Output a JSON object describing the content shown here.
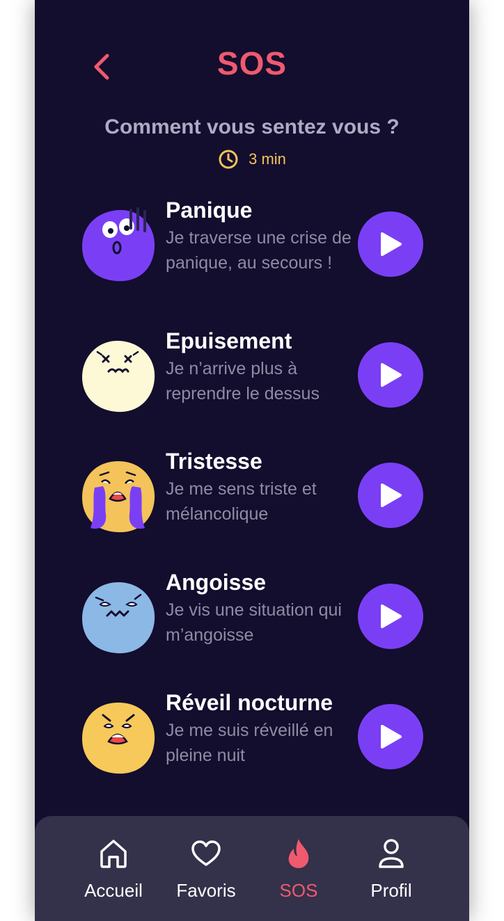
{
  "header": {
    "title": "SOS",
    "back_icon": "chevron-left-icon"
  },
  "prompt": {
    "question": "Comment vous sentez vous ?",
    "duration": "3 min",
    "duration_icon": "clock-icon"
  },
  "moods": [
    {
      "title": "Panique",
      "description": "Je traverse une crise de panique, au secours !",
      "emoji_icon": "panicked-face-icon",
      "emoji_color": "#7a3ff5"
    },
    {
      "title": "Epuisement",
      "description": "Je n’arrive plus à reprendre  le dessus",
      "emoji_icon": "exhausted-face-icon",
      "emoji_color": "#fdf9d6"
    },
    {
      "title": "Tristesse",
      "description": "Je me sens triste et mélancolique",
      "emoji_icon": "crying-face-icon",
      "emoji_color": "#f4c35a"
    },
    {
      "title": "Angoisse",
      "description": "Je vis une situation qui m’angoisse",
      "emoji_icon": "anxious-face-icon",
      "emoji_color": "#8cb8e6"
    },
    {
      "title": "Réveil nocturne",
      "description": "Je me suis réveillé en pleine nuit",
      "emoji_icon": "shocked-face-icon",
      "emoji_color": "#f7c95a"
    }
  ],
  "nav": [
    {
      "label": "Accueil",
      "icon": "home-icon"
    },
    {
      "label": "Favoris",
      "icon": "heart-icon"
    },
    {
      "label": "SOS",
      "icon": "flame-icon",
      "active": true
    },
    {
      "label": "Profil",
      "icon": "user-icon"
    }
  ],
  "colors": {
    "background": "#130d2e",
    "accent": "#ef5a6f",
    "play": "#7a3ff5",
    "timer": "#f4c35a",
    "nav_bg": "#34314a"
  }
}
